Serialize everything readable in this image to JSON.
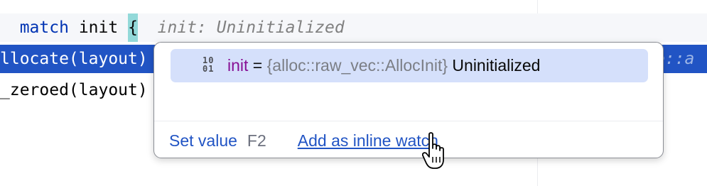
{
  "editor": {
    "line1": {
      "keyword": "match",
      "ident": "init",
      "brace": "{",
      "inlay_hint": "init: Uninitialized"
    },
    "line2": {
      "code": "llocate(layout)",
      "right_fragment": "e::a"
    },
    "line3": {
      "code": "_zeroed(layout)"
    }
  },
  "popup": {
    "row": {
      "icon": "binary-value-icon",
      "name": "init",
      "eq": "=",
      "type": "{alloc::raw_vec::AllocInit}",
      "value": "Uninitialized"
    },
    "actions": {
      "set_value": "Set value",
      "set_value_shortcut": "F2",
      "add_inline_watch": "Add as inline watch"
    }
  },
  "colors": {
    "selection_line": "#2154c4",
    "brace_highlight": "#93d9d9",
    "popup_row_highlight": "#d5e0fb",
    "link": "#2154c4"
  }
}
